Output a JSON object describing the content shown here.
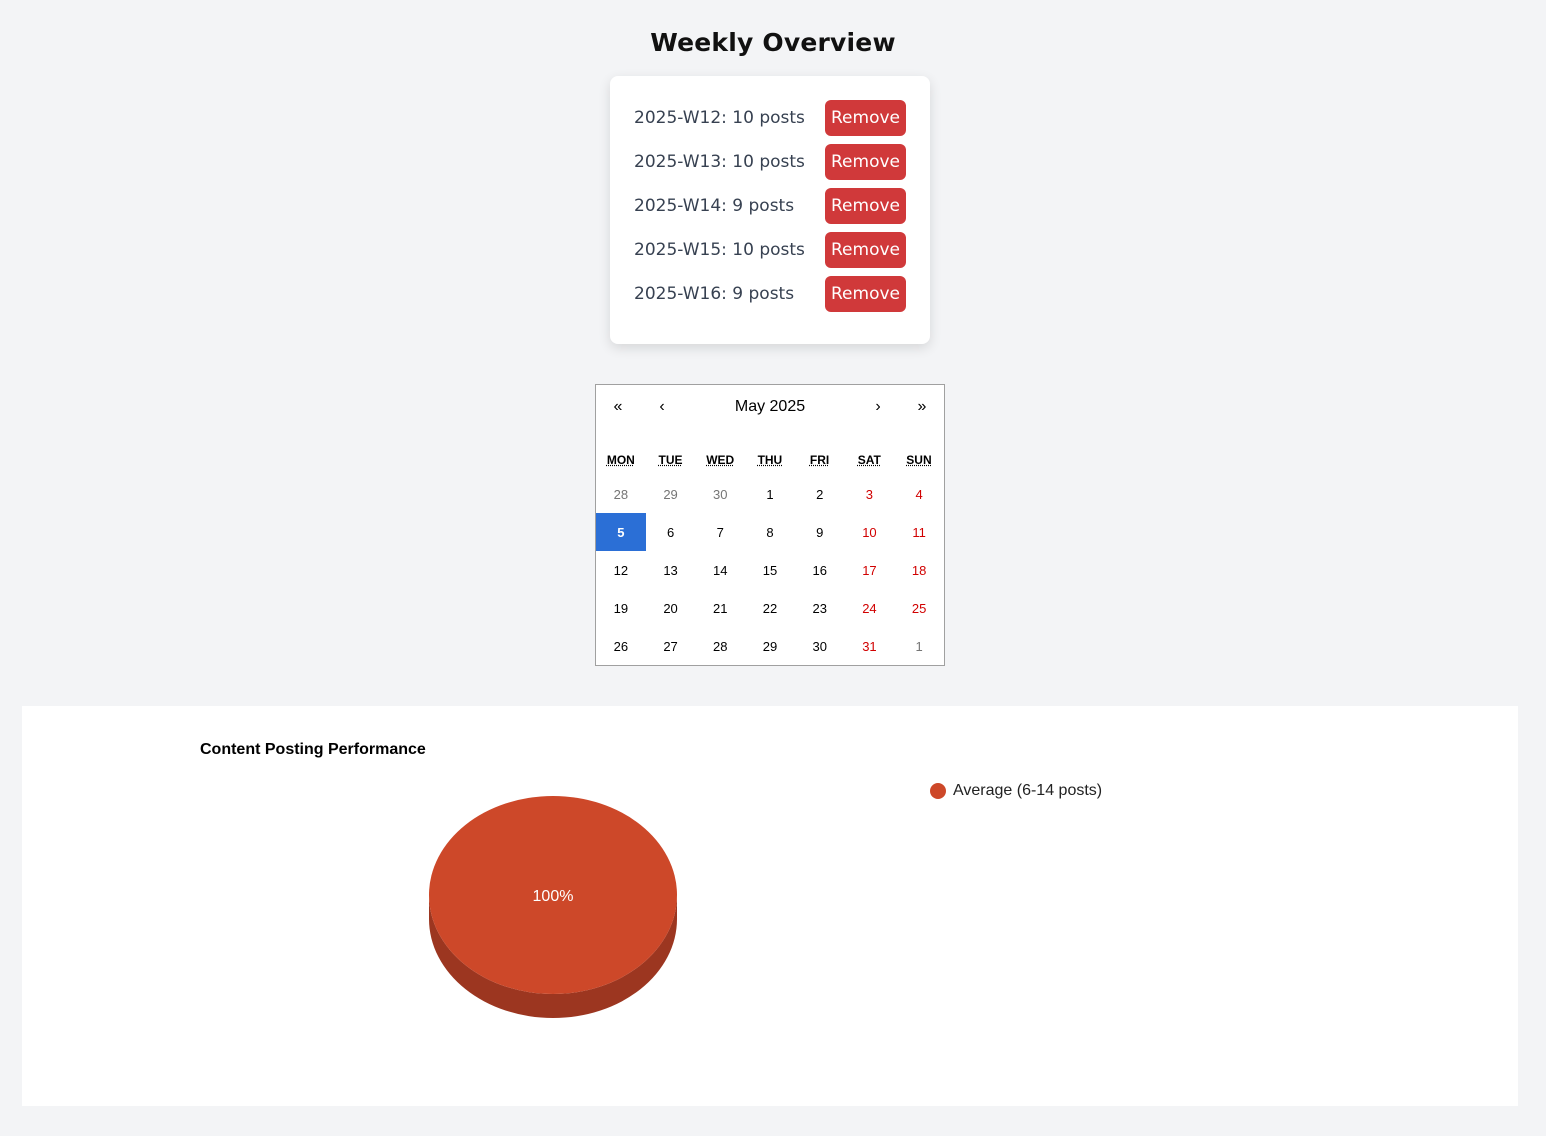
{
  "header": {
    "title": "Weekly Overview"
  },
  "weeks": {
    "remove_label": "Remove",
    "items": [
      {
        "label": "2025-W12: 10 posts"
      },
      {
        "label": "2025-W13: 10 posts"
      },
      {
        "label": "2025-W14: 9 posts"
      },
      {
        "label": "2025-W15: 10 posts"
      },
      {
        "label": "2025-W16: 9 posts"
      }
    ]
  },
  "calendar": {
    "month_label": "May 2025",
    "nav": {
      "prev_year": "«",
      "prev_month": "‹",
      "next_month": "›",
      "next_year": "»"
    },
    "weekdays": [
      "MON",
      "TUE",
      "WED",
      "THU",
      "FRI",
      "SAT",
      "SUN"
    ],
    "selected_day": "5",
    "weeks": [
      [
        "28",
        "29",
        "30",
        "1",
        "2",
        "3",
        "4"
      ],
      [
        "5",
        "6",
        "7",
        "8",
        "9",
        "10",
        "11"
      ],
      [
        "12",
        "13",
        "14",
        "15",
        "16",
        "17",
        "18"
      ],
      [
        "19",
        "20",
        "21",
        "22",
        "23",
        "24",
        "25"
      ],
      [
        "26",
        "27",
        "28",
        "29",
        "30",
        "31",
        "1"
      ]
    ]
  },
  "colors": {
    "accent_red": "#d0393a",
    "selected_blue": "#2b6fd6",
    "pie_top": "#cd4829",
    "pie_side": "#9c3620"
  },
  "chart_data": {
    "type": "pie",
    "title": "Content Posting Performance",
    "slices": [
      {
        "label": "Average (6-14 posts)",
        "value": 100,
        "display": "100%",
        "color": "#cd4829"
      }
    ],
    "legend_position": "right"
  }
}
